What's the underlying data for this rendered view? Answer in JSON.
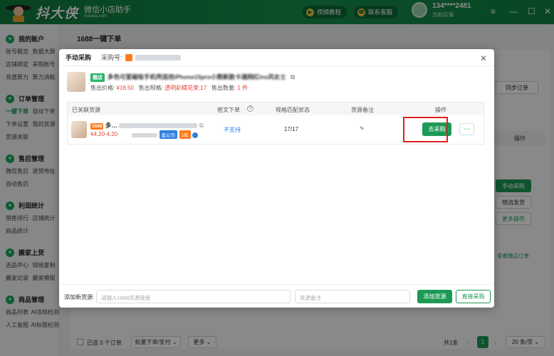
{
  "app": {
    "title": "抖大侠",
    "subtitle": "微信小店助手",
    "domain": "fcdaxia.com",
    "video_tutorial": "视频教程",
    "contact_service": "联系客服",
    "user_phone": "134****2481",
    "user_store": "当前店铺",
    "accent_color": "#1d9a55"
  },
  "sidebar": {
    "sections": [
      {
        "title": "我的账户",
        "icon": "user-icon",
        "rows": [
          [
            "账号概览",
            "数据大屏"
          ],
          [
            "店铺绑定",
            "采购账号"
          ],
          [
            "充值算力",
            "算力消耗"
          ]
        ]
      },
      {
        "title": "订单管理",
        "icon": "order-icon",
        "rows": [
          [
            "一键下单",
            "自动下单"
          ],
          [
            "下单设置",
            "我的货源"
          ],
          [
            "货源关联",
            ""
          ]
        ]
      },
      {
        "title": "售后管理",
        "icon": "aftersale-icon",
        "rows": [
          [
            "微信售后",
            "退货地址"
          ],
          [
            "自动售后",
            ""
          ]
        ]
      },
      {
        "title": "利润统计",
        "icon": "profit-icon",
        "rows": [
          [
            "销售排行",
            "店铺统计"
          ],
          [
            "商品统计",
            ""
          ]
        ]
      },
      {
        "title": "搬家上货",
        "icon": "move-icon",
        "rows": [
          [
            "选品中心",
            "链接复制"
          ],
          [
            "搬家记录",
            "搬家模版"
          ]
        ]
      },
      {
        "title": "商品管理",
        "icon": "goods-icon",
        "rows": [
          [
            "商品列表",
            "AI违规检测"
          ],
          [
            "人工鉴图",
            "AI标题检测"
          ]
        ]
      }
    ]
  },
  "page": {
    "title": "1688一键下单",
    "sync_orders": "同步订单",
    "operation": "操作",
    "manual_purchase": "手动采购",
    "logistics_ship": "物流发货",
    "more_ops": "更多操作",
    "view_store_order": "查看微店订单",
    "selected": "已选 0 个订单",
    "batch_order": "批量下单/支付",
    "more": "更多",
    "total": "共1条",
    "page_num": "1",
    "page_size": "20 条/页"
  },
  "modal": {
    "title": "手动采购",
    "purchase_no_label": "采购号:",
    "product": {
      "tag": "微店",
      "name": "多色可爱磁吸手机壳适用iPhone15pro小熊新款卡通网红ins风女士",
      "price_label": "售出价格:",
      "price": "¥16.50",
      "spec_label": "售出规格:",
      "spec": "透明彩蝶花束;17",
      "qty_label": "售出数量:",
      "qty": "1 件"
    },
    "table": {
      "headers": [
        "已关联货源",
        "密文下单",
        "规格匹配状态",
        "货源备注",
        "操作"
      ],
      "row": {
        "tag": "1688",
        "name": "多…",
        "price": "¥4.20-4.20",
        "badge_company": "盘公司",
        "badge_year": "1年",
        "cipher": "不支持",
        "spec_match": "17/17",
        "buy": "去采购"
      }
    },
    "footer": {
      "add_label": "添加新货源:",
      "link_placeholder": "请输入1688货源链接",
      "remark_placeholder": "货源备注",
      "add_button": "添加货源",
      "direct_button": "直接采购"
    }
  }
}
